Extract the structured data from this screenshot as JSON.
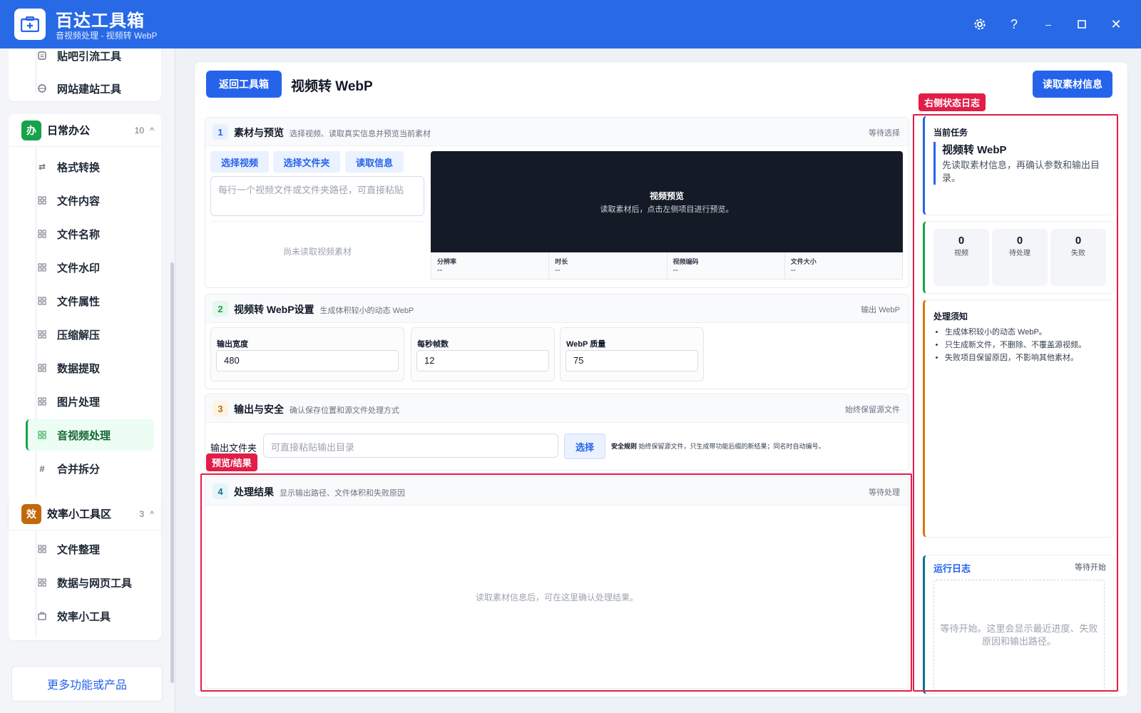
{
  "app": {
    "title": "百达工具箱",
    "subtitle": "音视频处理 - 视频转 WebP"
  },
  "sidebar": {
    "top_items": [
      "贴吧引流工具",
      "网站建站工具"
    ],
    "group_office": {
      "badge": "办",
      "name": "日常办公",
      "count": "10",
      "items": [
        "格式转换",
        "文件内容",
        "文件名称",
        "文件水印",
        "文件属性",
        "压缩解压",
        "数据提取",
        "图片处理",
        "音视频处理",
        "合并拆分"
      ]
    },
    "group_efficiency": {
      "badge": "效",
      "name": "效率小工具区",
      "count": "3",
      "items": [
        "文件整理",
        "数据与网页工具",
        "效率小工具"
      ]
    },
    "more_button": "更多功能或产品"
  },
  "header": {
    "back_button": "返回工具箱",
    "title": "视频转 WebP",
    "read_info_button": "读取素材信息"
  },
  "section1": {
    "num": "1",
    "title": "素材与预览",
    "desc": "选择视频、读取真实信息并预览当前素材",
    "status": "等待选择",
    "buttons": [
      "选择视频",
      "选择文件夹",
      "读取信息"
    ],
    "input_placeholder": "每行一个视频文件或文件夹路径，可直接粘贴",
    "empty_text": "尚未读取视频素材",
    "preview_title": "视频预览",
    "preview_desc": "读取素材后，点击左侧项目进行预览。",
    "meta": [
      {
        "label": "分辨率",
        "value": "--"
      },
      {
        "label": "时长",
        "value": "--"
      },
      {
        "label": "视频编码",
        "value": "--"
      },
      {
        "label": "文件大小",
        "value": "--"
      }
    ]
  },
  "section2": {
    "num": "2",
    "title": "视频转 WebP设置",
    "desc": "生成体积较小的动态 WebP",
    "status": "输出 WebP",
    "fields": [
      {
        "label": "输出宽度",
        "value": "480"
      },
      {
        "label": "每秒帧数",
        "value": "12"
      },
      {
        "label": "WebP 质量",
        "value": "75"
      }
    ]
  },
  "section3": {
    "num": "3",
    "title": "输出与安全",
    "desc": "确认保存位置和源文件处理方式",
    "status": "始终保留源文件",
    "output_label": "输出文件夹",
    "output_placeholder": "可直接粘贴输出目录",
    "choose_button": "选择",
    "rule_label": "安全规则",
    "rule_text": "始终保留源文件，只生成带功能后缀的新结果；同名时自动编号。"
  },
  "section4": {
    "num": "4",
    "title": "处理结果",
    "desc": "显示输出路径、文件体积和失败原因",
    "status": "等待处理",
    "empty_text": "读取素材信息后，可在这里确认处理结果。"
  },
  "callouts": {
    "right": "右侧状态日志",
    "left": "预览/结果"
  },
  "right_panel": {
    "task_label": "当前任务",
    "task_title": "视频转 WebP",
    "task_desc": "先读取素材信息，再确认参数和输出目录。",
    "stats": [
      {
        "num": "0",
        "label": "视频"
      },
      {
        "num": "0",
        "label": "待处理"
      },
      {
        "num": "0",
        "label": "失败"
      }
    ],
    "notes_title": "处理须知",
    "notes": [
      "生成体积较小的动态 WebP。",
      "只生成新文件，不删除、不覆盖源视频。",
      "失败项目保留原因，不影响其他素材。"
    ],
    "log_title": "运行日志",
    "log_status": "等待开始",
    "log_text": "等待开始。这里会显示最近进度、失败原因和输出路径。"
  },
  "colors": {
    "brand": "#2869e6",
    "primary": "#2563eb",
    "callout": "#e11d48",
    "office_badge": "#16a34a",
    "efficiency_badge": "#c2690c"
  }
}
